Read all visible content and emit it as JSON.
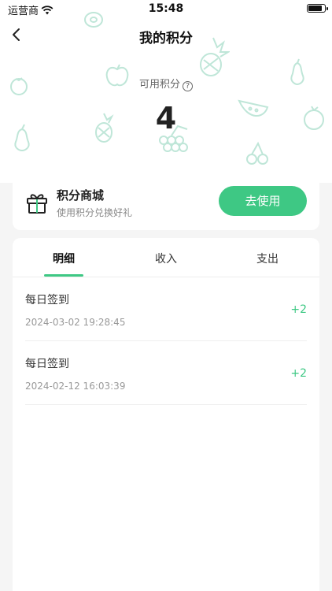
{
  "status_bar": {
    "carrier": "运营商",
    "time": "15:48"
  },
  "nav": {
    "title": "我的积分"
  },
  "points": {
    "label": "可用积分",
    "help_icon": "?",
    "value": "4"
  },
  "mall": {
    "title": "积分商城",
    "subtitle": "使用积分兑换好礼",
    "button": "去使用"
  },
  "tabs": [
    {
      "label": "明细",
      "active": true
    },
    {
      "label": "收入",
      "active": false
    },
    {
      "label": "支出",
      "active": false
    }
  ],
  "records": [
    {
      "title": "每日签到",
      "time": "2024-03-02 19:28:45",
      "amount": "+2"
    },
    {
      "title": "每日签到",
      "time": "2024-02-12 16:03:39",
      "amount": "+2"
    }
  ],
  "colors": {
    "accent": "#3ec884",
    "decor": "#bfe6d8"
  }
}
